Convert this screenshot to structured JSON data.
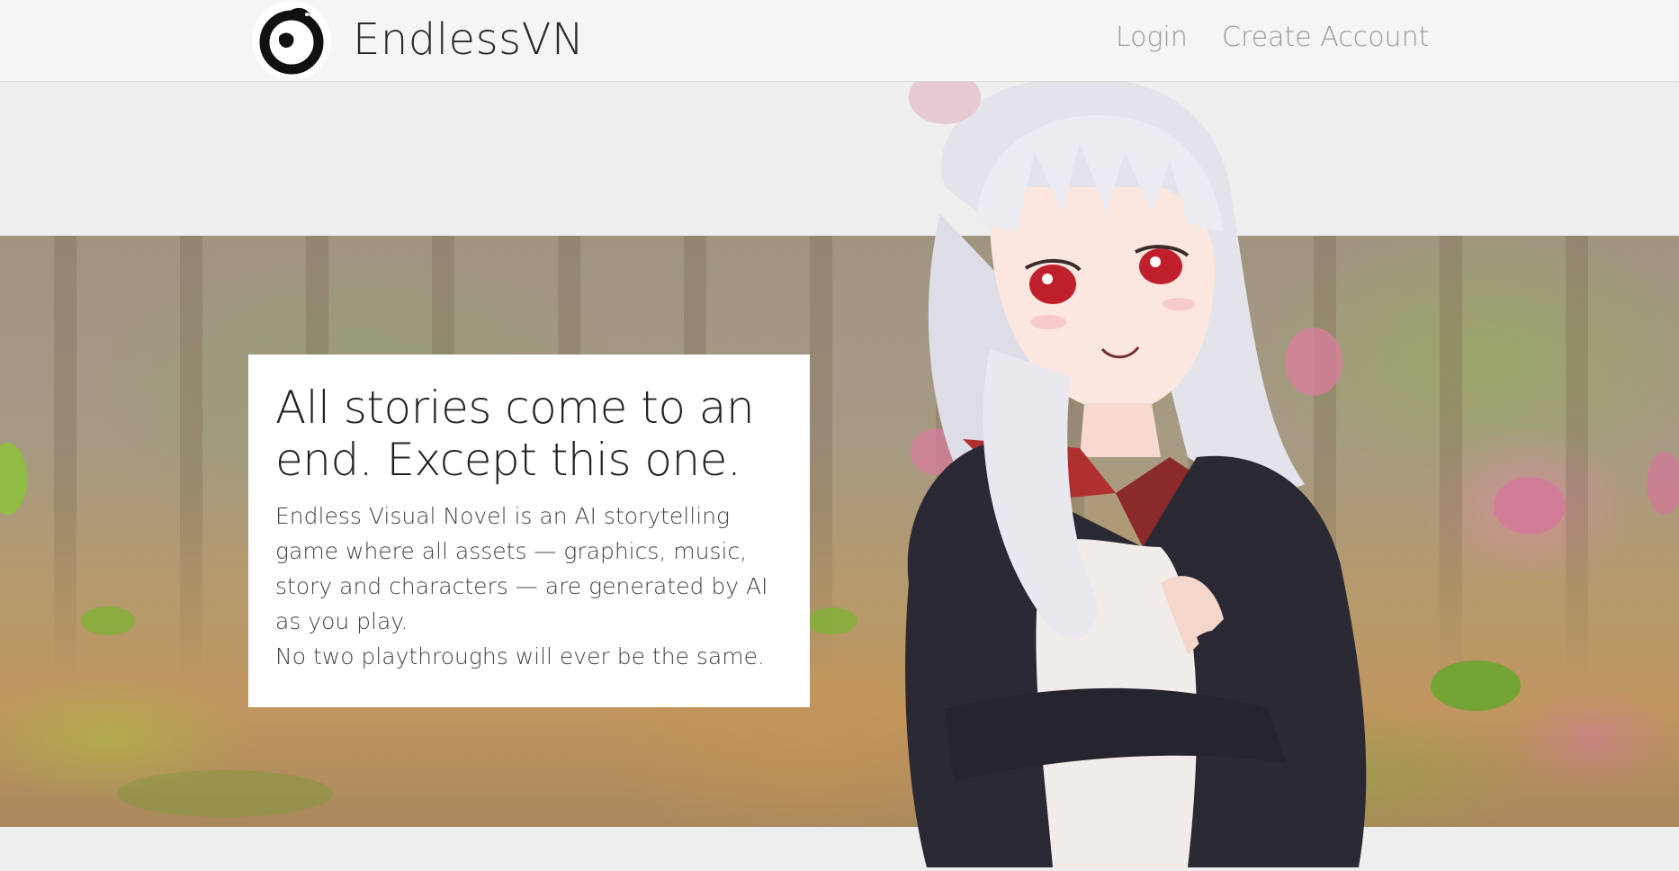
{
  "header": {
    "brand": "EndlessVN",
    "nav": {
      "login": "Login",
      "create_account": "Create Account"
    },
    "logo_icon": "ouroboros-dragon-icon"
  },
  "hero": {
    "title": "All stories come to an end. Except this one.",
    "description": "Endless Visual Novel is an AI storytelling game where all assets — graphics, music, story and characters — are generated by AI as you play.",
    "tagline": "No two playthroughs will ever be the same.",
    "background": "forest-clearing-image",
    "character": "anime-girl-character-illustration"
  },
  "colors": {
    "header_bg": "#f5f5f5",
    "page_bg": "#eeeeee",
    "nav_text": "#9a9a9a",
    "brand_text": "#2a2a2a"
  }
}
